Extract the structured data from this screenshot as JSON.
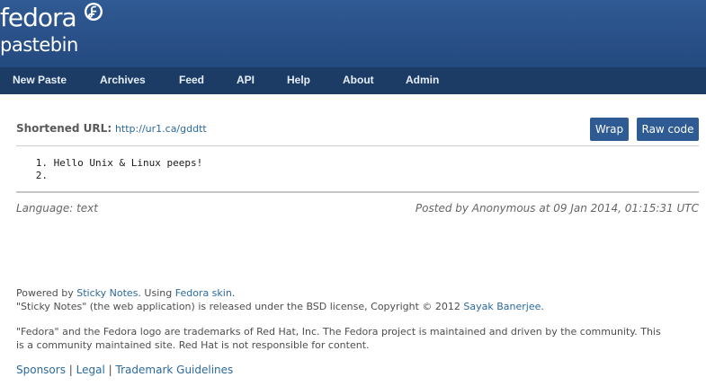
{
  "logo": {
    "line1": "fedora",
    "line2": "pastebin"
  },
  "colors": {
    "header": "#2a5088",
    "nav": "#1c3c66",
    "button": "#2e5b93",
    "link": "#2a6a9e"
  },
  "nav": {
    "items": [
      {
        "label": "New Paste"
      },
      {
        "label": "Archives"
      },
      {
        "label": "Feed"
      },
      {
        "label": "API"
      },
      {
        "label": "Help"
      },
      {
        "label": "About"
      },
      {
        "label": "Admin"
      }
    ]
  },
  "paste": {
    "shortened_label": "Shortened URL",
    "shortened_url": "http://ur1.ca/gddtt",
    "wrap_label": "Wrap",
    "raw_label": "Raw code",
    "lines": [
      {
        "num": "1.",
        "text": "Hello Unix & Linux peeps!"
      },
      {
        "num": "2.",
        "text": ""
      }
    ],
    "language": "Language: text",
    "posted": "Posted by Anonymous at 09 Jan 2014, 01:15:31 UTC"
  },
  "footer": {
    "powered_prefix": "Powered by",
    "sticky_notes": "Sticky Notes",
    "using": ". Using",
    "fedora_skin": "Fedora skin",
    "powered_suffix": ".",
    "license_text": "\"Sticky Notes\" (the web application) is released under the BSD license, Copyright © 2012",
    "author": "Sayak Banerjee",
    "license_suffix": ".",
    "trademark_line1": "\"Fedora\" and the Fedora logo are trademarks of Red Hat, Inc. The Fedora project is maintained and driven by the community. This",
    "trademark_line2": "is a community maintained site. Red Hat is not responsible for content.",
    "links": {
      "sponsors": "Sponsors",
      "legal": "Legal",
      "trademark": "Trademark Guidelines",
      "sep": "|"
    }
  }
}
